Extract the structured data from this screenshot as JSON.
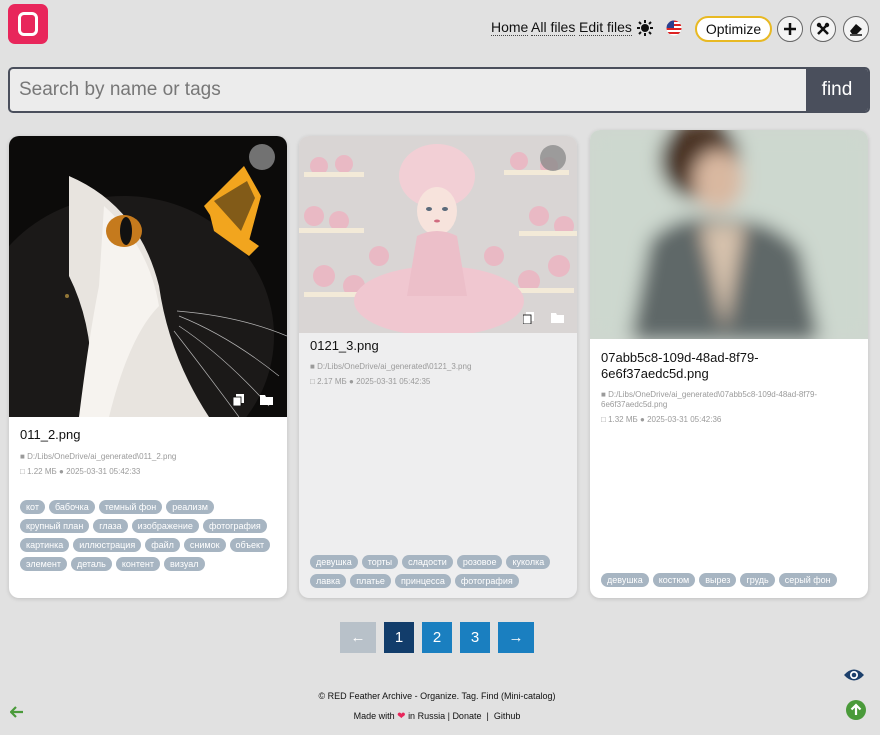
{
  "header": {
    "nav": [
      "Home",
      "All files",
      "Edit files"
    ],
    "optimize_label": "Optimize",
    "icons": [
      "theme-toggle-icon",
      "us-flag-icon",
      "plus-icon",
      "tools-icon",
      "eraser-icon"
    ]
  },
  "search": {
    "placeholder": "Search by name or tags",
    "button_label": "find"
  },
  "cards": [
    {
      "title": "011_2.png",
      "path": "D:/Libs/OneDrive/ai_generated\\011_2.png",
      "size": "1.22 МБ",
      "date": "2025-03-31 05:42:33",
      "tags": [
        "кот",
        "бабочка",
        "темный фон",
        "реализм",
        "крупный план",
        "глаза",
        "изображение",
        "фотография",
        "картинка",
        "иллюстрация",
        "файл",
        "снимок",
        "объект",
        "элемент",
        "деталь",
        "контент",
        "визуал"
      ]
    },
    {
      "title": "0121_3.png",
      "path": "D:/Libs/OneDrive/ai_generated\\0121_3.png",
      "size": "2.17 МБ",
      "date": "2025-03-31 05:42:35",
      "tags": [
        "девушка",
        "торты",
        "сладости",
        "розовое",
        "куколка",
        "лавка",
        "платье",
        "принцесса",
        "фотография"
      ]
    },
    {
      "title": "07abb5c8-109d-48ad-8f79-6e6f37aedc5d.png",
      "path": "D:/Libs/OneDrive/ai_generated\\07abb5c8-109d-48ad-8f79-6e6f37aedc5d.png",
      "size": "1.32 МБ",
      "date": "2025-03-31 05:42:36",
      "tags": [
        "девушка",
        "костюм",
        "вырез",
        "грудь",
        "серый фон"
      ]
    }
  ],
  "pagination": {
    "prev": "←",
    "pages": [
      "1",
      "2",
      "3"
    ],
    "next": "→",
    "current": "1"
  },
  "footer": {
    "line1": "© RED Feather Archive - Organize. Tag. Find (Mini-catalog)",
    "made_with": "Made with",
    "in_russia": "in Russia |",
    "donate": "Donate",
    "sep": "|",
    "github": "Github"
  },
  "colors": {
    "brand": "#e8265b",
    "dark": "#4a4f5c",
    "page_active": "#123d6b",
    "page": "#1a7fc0",
    "tag": "#a7b5c2",
    "optimize_border": "#e8b923"
  }
}
